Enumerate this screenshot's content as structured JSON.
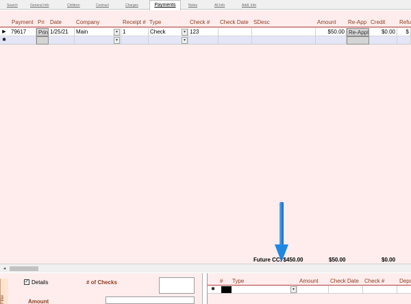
{
  "tabs": [
    {
      "label": "Search"
    },
    {
      "label": "General Info"
    },
    {
      "label": "Children"
    },
    {
      "label": "Contract"
    },
    {
      "label": "Charges"
    },
    {
      "label": "Payments"
    },
    {
      "label": "Notes"
    },
    {
      "label": "All Info"
    },
    {
      "label": "Addl. Info"
    }
  ],
  "grid": {
    "columns": [
      "Payment",
      "Pri",
      "Date",
      "Company",
      "Receipt #",
      "Type",
      "Check #",
      "Check Date",
      "SDesc",
      "Amount",
      "Re-App",
      "Credit",
      "Refu"
    ],
    "row": {
      "selector": "▶",
      "payment": "79617",
      "pri": "Prin",
      "date": "1/25/21",
      "company": "Main",
      "receipt": "1",
      "type": "Check",
      "check_no": "123",
      "check_date": "",
      "sdesc": "",
      "amount": "$50.00",
      "reapp": "Re-Appl",
      "credit": "$0.00",
      "refund": "$"
    },
    "new_row_marker": "✱",
    "combo_arrow": "▾"
  },
  "totals": {
    "future_cc": "Future CC: $450.00",
    "amount": "$50.00",
    "credit": "$0.00"
  },
  "scroll": {
    "left_arrow": "◂"
  },
  "bottom_left": {
    "side_tab": "Filter",
    "details_checked": true,
    "check_mark": "✓",
    "details_label": "Details",
    "num_checks_label": "# of Checks",
    "amount_label": "Amount"
  },
  "bottom_right": {
    "columns": [
      "#",
      "Type",
      "Amount",
      "Check Date",
      "Check #",
      "Depo"
    ],
    "new_row_marker": "✱",
    "combo_arrow": "▾"
  },
  "colors": {
    "form_bg": "#ffeded",
    "header_text": "#8b3b1e",
    "arrow_blue": "#1e88e5"
  }
}
